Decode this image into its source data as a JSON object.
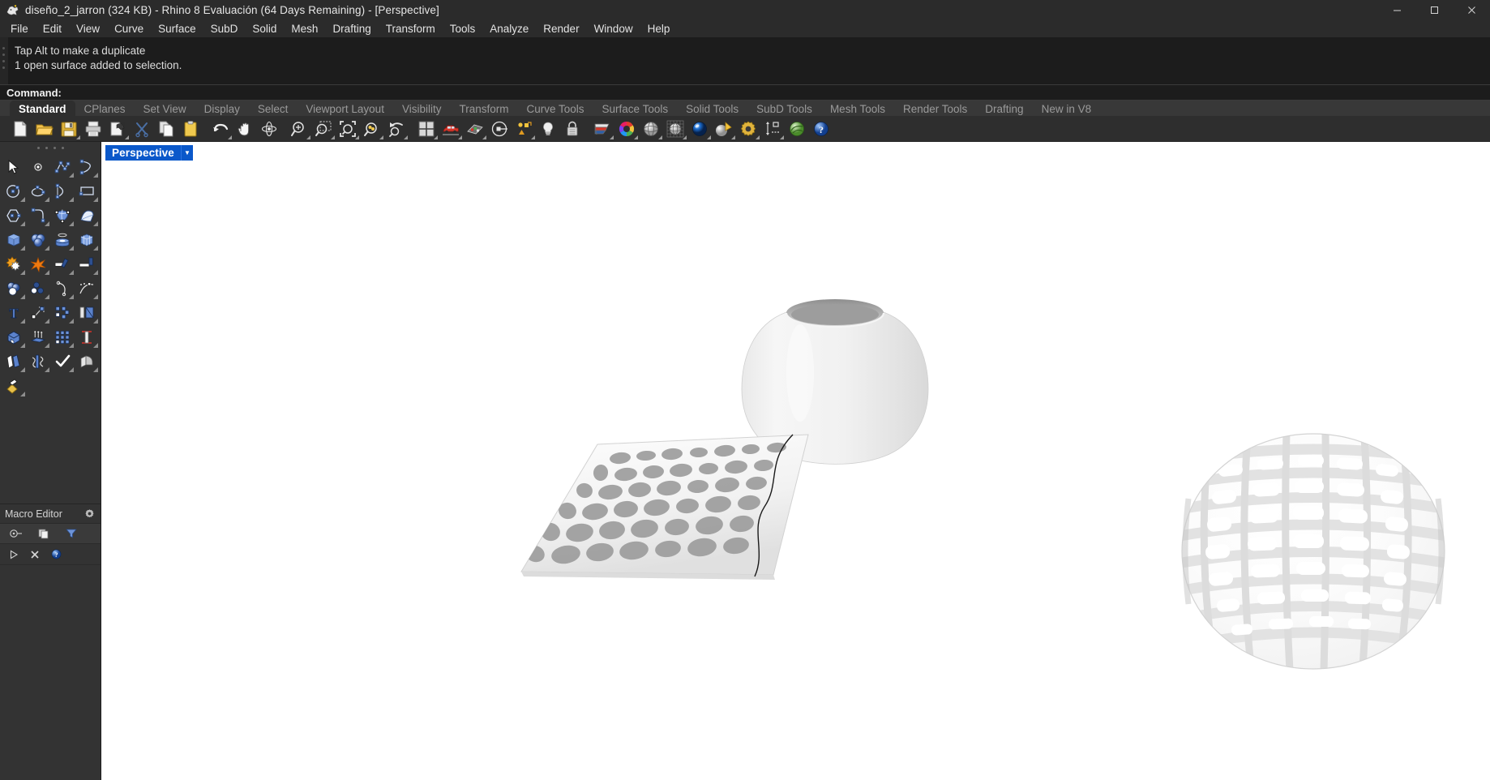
{
  "window": {
    "title": "diseño_2_jarron (324 KB) - Rhino 8 Evaluación (64 Days Remaining) - [Perspective]",
    "app_icon": "rhino-logo-icon",
    "controls": [
      {
        "name": "minimize-button",
        "glyph": "─"
      },
      {
        "name": "maximize-button",
        "glyph": "☐"
      },
      {
        "name": "close-button",
        "glyph": "✕"
      }
    ]
  },
  "menubar": {
    "items": [
      {
        "label": "File"
      },
      {
        "label": "Edit"
      },
      {
        "label": "View"
      },
      {
        "label": "Curve"
      },
      {
        "label": "Surface"
      },
      {
        "label": "SubD"
      },
      {
        "label": "Solid"
      },
      {
        "label": "Mesh"
      },
      {
        "label": "Drafting"
      },
      {
        "label": "Transform"
      },
      {
        "label": "Tools"
      },
      {
        "label": "Analyze"
      },
      {
        "label": "Render"
      },
      {
        "label": "Window"
      },
      {
        "label": "Help"
      }
    ]
  },
  "command_area": {
    "history": [
      "Tap Alt to make a duplicate",
      "1 open surface added to selection."
    ],
    "prompt_label": "Command:",
    "prompt_value": "",
    "prompt_placeholder": ""
  },
  "toolbar_tabs": {
    "active": "Standard",
    "items": [
      {
        "label": "Standard",
        "active": true
      },
      {
        "label": "CPlanes",
        "active": false
      },
      {
        "label": "Set View",
        "active": false
      },
      {
        "label": "Display",
        "active": false
      },
      {
        "label": "Select",
        "active": false
      },
      {
        "label": "Viewport Layout",
        "active": false
      },
      {
        "label": "Visibility",
        "active": false
      },
      {
        "label": "Transform",
        "active": false
      },
      {
        "label": "Curve Tools",
        "active": false
      },
      {
        "label": "Surface Tools",
        "active": false
      },
      {
        "label": "Solid Tools",
        "active": false
      },
      {
        "label": "SubD Tools",
        "active": false
      },
      {
        "label": "Mesh Tools",
        "active": false
      },
      {
        "label": "Render Tools",
        "active": false
      },
      {
        "label": "Drafting",
        "active": false
      },
      {
        "label": "New in V8",
        "active": false
      }
    ]
  },
  "main_toolbar": {
    "buttons": [
      {
        "name": "new-file-icon",
        "tooltip": "New"
      },
      {
        "name": "open-file-icon",
        "tooltip": "Open"
      },
      {
        "name": "save-file-icon",
        "tooltip": "Save"
      },
      {
        "name": "print-icon",
        "tooltip": "Print"
      },
      {
        "name": "cut-page-icon",
        "tooltip": "Cut"
      },
      {
        "name": "scissors-icon",
        "tooltip": "Cut"
      },
      {
        "name": "copy-icon",
        "tooltip": "Copy"
      },
      {
        "name": "paste-clipboard-icon",
        "tooltip": "Paste"
      },
      {
        "name": "undo-arrow-icon",
        "tooltip": "Undo"
      },
      {
        "name": "pan-hand-icon",
        "tooltip": "Pan"
      },
      {
        "name": "rotate-view-icon",
        "tooltip": "Rotate View"
      },
      {
        "name": "zoom-in-icon",
        "tooltip": "Zoom In"
      },
      {
        "name": "zoom-window-icon",
        "tooltip": "Zoom Window"
      },
      {
        "name": "zoom-extents-icon",
        "tooltip": "Zoom Extents"
      },
      {
        "name": "zoom-selected-icon",
        "tooltip": "Zoom Selected"
      },
      {
        "name": "zoom-previous-icon",
        "tooltip": "Zoom Previous"
      },
      {
        "name": "viewport-layout-icon",
        "tooltip": "4 Viewports"
      },
      {
        "name": "car-render-icon",
        "tooltip": "Render"
      },
      {
        "name": "grid-snap-icon",
        "tooltip": "Grid Snap"
      },
      {
        "name": "ortho-icon",
        "tooltip": "Ortho"
      },
      {
        "name": "layers-icon",
        "tooltip": "Layers"
      },
      {
        "name": "light-bulb-icon",
        "tooltip": "Lights"
      },
      {
        "name": "lock-icon",
        "tooltip": "Lock"
      },
      {
        "name": "layer-stack-icon",
        "tooltip": "Layer Manager"
      },
      {
        "name": "color-wheel-icon",
        "tooltip": "Color"
      },
      {
        "name": "shaded-sphere-icon",
        "tooltip": "Shaded"
      },
      {
        "name": "ghosted-sphere-icon",
        "tooltip": "Ghosted"
      },
      {
        "name": "rendered-sphere-icon",
        "tooltip": "Rendered"
      },
      {
        "name": "spotlight-icon",
        "tooltip": "Spotlight"
      },
      {
        "name": "gear-gold-icon",
        "tooltip": "Options"
      },
      {
        "name": "dimension-icon",
        "tooltip": "Dimension"
      },
      {
        "name": "grasshopper-icon",
        "tooltip": "Grasshopper"
      },
      {
        "name": "help-icon",
        "tooltip": "Help"
      }
    ]
  },
  "side_toolbar": {
    "buttons": [
      {
        "name": "select-arrow-icon"
      },
      {
        "name": "point-icon"
      },
      {
        "name": "polyline-icon"
      },
      {
        "name": "curve-interp-icon"
      },
      {
        "name": "circle-icon"
      },
      {
        "name": "ellipse-icon"
      },
      {
        "name": "arc-icon"
      },
      {
        "name": "rectangle-icon"
      },
      {
        "name": "polygon-icon"
      },
      {
        "name": "curve-fillet-icon"
      },
      {
        "name": "surface-patch-icon"
      },
      {
        "name": "surface-sweep-icon"
      },
      {
        "name": "box-icon"
      },
      {
        "name": "sphere-boolean-icon"
      },
      {
        "name": "cylinder-icon"
      },
      {
        "name": "subd-box-icon"
      },
      {
        "name": "boolean-union-icon"
      },
      {
        "name": "explode-icon"
      },
      {
        "name": "trim-icon"
      },
      {
        "name": "split-icon"
      },
      {
        "name": "offset-icon"
      },
      {
        "name": "blend-icon"
      },
      {
        "name": "curve-edit-icon"
      },
      {
        "name": "control-points-icon"
      },
      {
        "name": "text-icon"
      },
      {
        "name": "move-icon"
      },
      {
        "name": "copy-objects-icon"
      },
      {
        "name": "mirror-icon"
      },
      {
        "name": "cap-icon"
      },
      {
        "name": "extrude-icon"
      },
      {
        "name": "array-icon"
      },
      {
        "name": "scale-icon"
      },
      {
        "name": "unroll-icon"
      },
      {
        "name": "flow-icon"
      },
      {
        "name": "check-icon"
      },
      {
        "name": "fillet-edge-icon"
      },
      {
        "name": "paint-bucket-icon"
      }
    ]
  },
  "macro_editor": {
    "title": "Macro Editor",
    "gear_icon": "gear-icon",
    "toolbar_buttons": [
      {
        "name": "macro-run-icon"
      },
      {
        "name": "macro-copy-icon"
      },
      {
        "name": "macro-filter-icon"
      }
    ],
    "toolbar2_buttons": [
      {
        "name": "macro-play-icon"
      },
      {
        "name": "macro-stop-icon"
      },
      {
        "name": "macro-help-icon"
      }
    ],
    "content": ""
  },
  "viewport": {
    "label": "Perspective",
    "dropdown_glyph": "▼",
    "background": "#ffffff",
    "objects": [
      {
        "name": "vase-bowl-solid",
        "type": "closed-surface-bowl"
      },
      {
        "name": "perforated-panel-flat",
        "type": "lattice-panel-with-curve"
      },
      {
        "name": "lattice-vase-sphere",
        "type": "perforated-spherical-vase"
      }
    ]
  },
  "colors": {
    "title_bar": "#2b2b2b",
    "menu_bar": "#2b2b2b",
    "command_bg": "#1c1c1c",
    "tab_bar": "#383838",
    "tab_active_bg": "#2e2e2e",
    "toolbar_bg": "#2e2e2e",
    "panel_bg": "#333333",
    "viewport_bg": "#ffffff",
    "viewport_label_bg": "#0a58ca",
    "text": "#d8d8d8",
    "text_dim": "#9a9a9a"
  }
}
